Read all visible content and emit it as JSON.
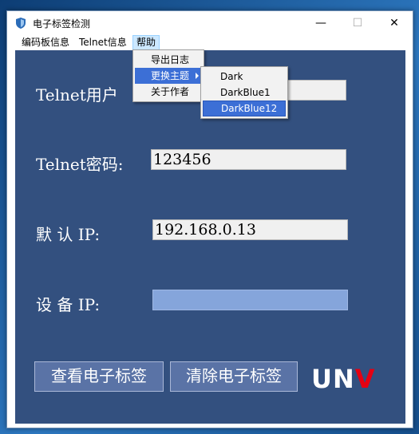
{
  "window": {
    "title": "电子标签检测",
    "minimize_glyph": "—",
    "maximize_glyph": "☐",
    "close_glyph": "✕"
  },
  "menubar": {
    "items": [
      {
        "label": "编码板信息"
      },
      {
        "label": "Telnet信息"
      },
      {
        "label": "帮助"
      }
    ]
  },
  "help_menu": {
    "items": [
      {
        "label": "导出日志"
      },
      {
        "label": "更换主题"
      },
      {
        "label": "关于作者"
      }
    ]
  },
  "theme_submenu": {
    "items": [
      {
        "label": "Dark"
      },
      {
        "label": "DarkBlue1"
      },
      {
        "label": "DarkBlue12"
      }
    ],
    "selected": "DarkBlue12"
  },
  "form": {
    "telnet_user_label": "Telnet用户",
    "telnet_user_value": "",
    "telnet_password_label": "Telnet密码:",
    "telnet_password_value": "123456",
    "default_ip_label": "默 认 IP:",
    "default_ip_value": "192.168.0.13",
    "device_ip_label": "设 备 IP:",
    "device_ip_value": ""
  },
  "actions": {
    "view_label": "查看电子标签",
    "clear_label": "清除电子标签"
  },
  "logo": {
    "text_main": "UN",
    "text_accent": "V"
  },
  "colors": {
    "client_background": "#33507f",
    "field_background": "#f0f0f0",
    "empty_field_background": "#85a5db",
    "button_background": "#5a73a6",
    "menu_highlight": "#3c6fd6"
  }
}
